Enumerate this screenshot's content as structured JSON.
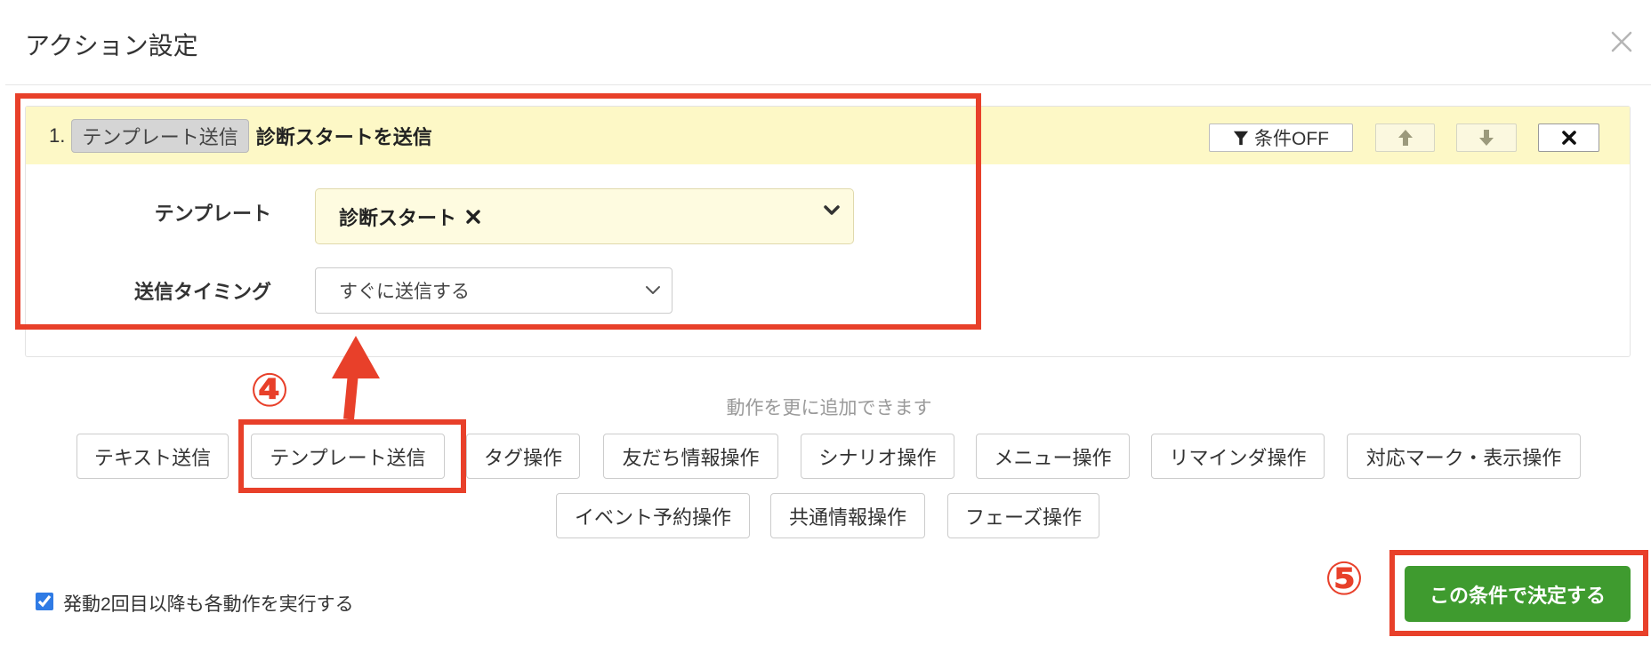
{
  "dialog": {
    "title": "アクション設定",
    "close_icon": "close-icon"
  },
  "action": {
    "index": "1.",
    "type_badge": "テンプレート送信",
    "summary": "診断スタートを送信",
    "condition_button": "条件OFF",
    "icons": [
      "filter-icon",
      "arrow-up-icon",
      "arrow-down-icon",
      "delete-icon"
    ]
  },
  "fields": {
    "template_label": "テンプレート",
    "template_value": "診断スタート",
    "template_icons": [
      "clear-icon",
      "chevron-down-icon"
    ],
    "timing_label": "送信タイミング",
    "timing_value": "すぐに送信する"
  },
  "add_actions": {
    "hint": "動作を更に追加できます",
    "row1": [
      "テキスト送信",
      "テンプレート送信",
      "タグ操作",
      "友だち情報操作",
      "シナリオ操作",
      "メニュー操作",
      "リマインダ操作",
      "対応マーク・表示操作"
    ],
    "row2": [
      "イベント予約操作",
      "共通情報操作",
      "フェーズ操作"
    ]
  },
  "annotations": {
    "step4": "④",
    "step5": "⑤"
  },
  "footer": {
    "repeat_label": "発動2回目以降も各動作を実行する",
    "repeat_checked": true,
    "submit_label": "この条件で決定する"
  },
  "colors": {
    "annotation_red": "#e8402a",
    "submit_green": "#3f9b2f",
    "header_yellow": "#fdf8c6",
    "select_yellow": "#fefbe0",
    "checkbox_blue": "#2f7be5"
  }
}
